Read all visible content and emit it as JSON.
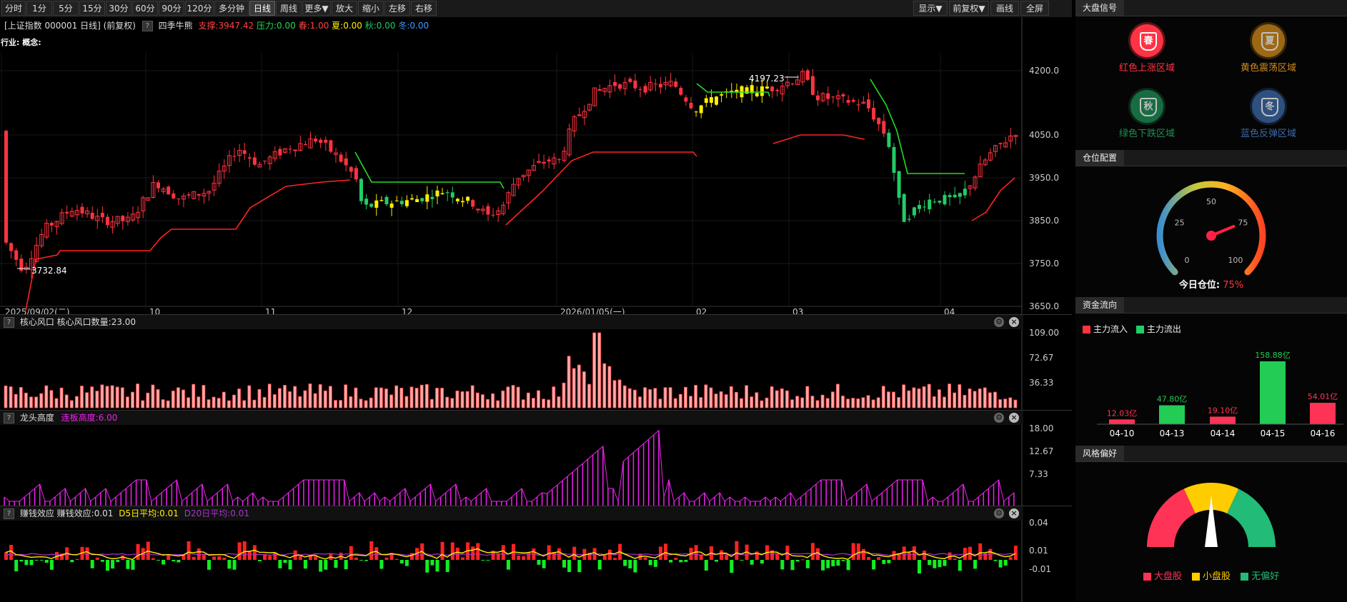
{
  "toolbar": {
    "left_buttons": [
      "分时",
      "1分",
      "5分",
      "15分",
      "30分",
      "60分",
      "90分",
      "120分",
      "多分钟",
      "日线",
      "周线",
      "更多▼",
      "放大",
      "缩小",
      "左移",
      "右移"
    ],
    "active": "日线",
    "right_buttons": [
      "显示▼",
      "前复权▼",
      "画线",
      "全屏"
    ]
  },
  "main_panel": {
    "header_prefix": "[上证指数 000001 日线]  (前复权)",
    "indicator_name": "四季牛熊",
    "support": "支撑:3947.42",
    "pressure": "压力:0.00",
    "spring": "春:1.00",
    "summer": "夏:0.00",
    "autumn": "秋:0.00",
    "winter": "冬:0.00",
    "industry_line": "行业: 概念:",
    "high_label": "4197.23",
    "low_label": "3732.84",
    "y_ticks": [
      "4200.0",
      "4050.0",
      "3950.0",
      "3850.0",
      "3750.0",
      "3650.0"
    ],
    "x_ticks": [
      "2025/09/02(二)",
      "10",
      "11",
      "12",
      "2026/01/05(一)",
      "02",
      "03",
      "04"
    ]
  },
  "sub1": {
    "title": "核心风口",
    "value": "核心风口数量:23.00",
    "y_ticks": [
      "109.00",
      "72.67",
      "36.33"
    ]
  },
  "sub2": {
    "title": "龙头高度",
    "value": "连板高度:6.00",
    "y_ticks": [
      "18.00",
      "12.67",
      "7.33"
    ]
  },
  "sub3": {
    "title": "赚钱效应",
    "value": "赚钱效应:0.01",
    "d5": "D5日平均:0.01",
    "d20": "D20日平均:0.01",
    "y_ticks": [
      "0.04",
      "0.01",
      "-0.01"
    ]
  },
  "right": {
    "signal_header": "大盘信号",
    "signals": [
      {
        "icon": "春",
        "label": "红色上涨区域",
        "color": "#ff3344"
      },
      {
        "icon": "夏",
        "label": "黄色震荡区域",
        "color": "#d08a1a"
      },
      {
        "icon": "秋",
        "label": "绿色下跌区域",
        "color": "#1f8f55"
      },
      {
        "icon": "冬",
        "label": "蓝色反弹区域",
        "color": "#3c6aa8"
      }
    ],
    "position_header": "仓位配置",
    "gauge_ticks": [
      "0",
      "25",
      "50",
      "75",
      "100"
    ],
    "position_value": 75,
    "position_label": "今日仓位:",
    "position_text": "75%",
    "flow_header": "资金流向",
    "flow_legend": [
      "主力流入",
      "主力流出"
    ],
    "style_header": "风格偏好",
    "style_legend": [
      "大盘股",
      "小盘股",
      "无偏好"
    ]
  },
  "chart_data": [
    {
      "type": "bar",
      "title": "资金流向",
      "categories": [
        "04-10",
        "04-13",
        "04-14",
        "04-15",
        "04-16"
      ],
      "values": [
        12.03,
        47.8,
        19.1,
        158.88,
        54.01
      ],
      "labels": [
        "12.03亿",
        "47.80亿",
        "19.10亿",
        "158.88亿",
        "54.01亿"
      ],
      "directions": [
        "in",
        "out",
        "in",
        "out",
        "in"
      ]
    }
  ],
  "colors": {
    "up": "#ff3340",
    "down": "#22cc66",
    "yellow": "#ffee00",
    "magenta": "#ee22ee",
    "pink": "#ffaaaa"
  }
}
